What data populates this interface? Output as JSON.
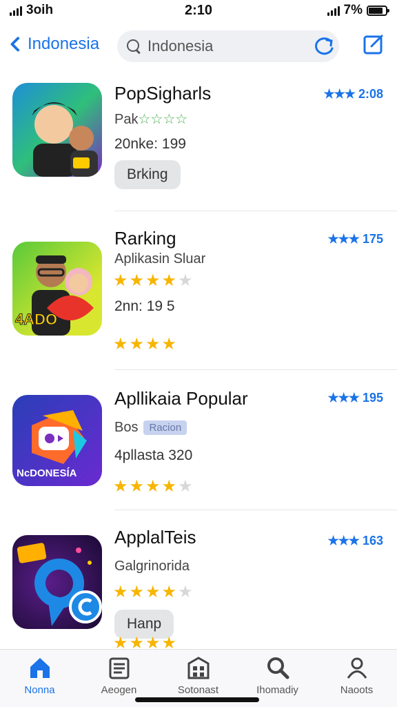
{
  "status_bar": {
    "carrier": "3oih",
    "time": "2:10",
    "battery": "7%"
  },
  "nav": {
    "back_label": "Indonesia",
    "search": {
      "value": "Indonesia",
      "placeholder": "Indonesia"
    }
  },
  "apps": [
    {
      "title": "PopSighar​ls",
      "subtitle": "Pak",
      "subtitle_stars": "☆☆☆☆",
      "meta": "20nke: 199",
      "right_stars": "★★★",
      "right_value": "2:08",
      "button": "Brking",
      "icon_colors": [
        "#1e8fd6",
        "#2fbf7a",
        "#7a2fbf"
      ],
      "icon_text": ""
    },
    {
      "title": "Rarking",
      "subtitle": "Aplikasin Sluar",
      "rating": 4,
      "meta": "2nn: 19 5",
      "right_stars": "★★★",
      "right_value": "175",
      "bottom_rating": 4,
      "icon_colors": [
        "#58c93a",
        "#d8e630",
        "#e8332b"
      ],
      "icon_text": "4ADO"
    },
    {
      "title": "Apllikaia Popular",
      "subtitle": "Bos",
      "badge": "Racion",
      "meta": "4pllasta 320",
      "right_stars": "★★★",
      "right_value": "195",
      "rating": 4,
      "icon_colors": [
        "#2a3fb8",
        "#6a2ad0",
        "#ff6b2b"
      ],
      "icon_text": "NcDONESÍA"
    },
    {
      "title": "ApplalTeis",
      "subtitle": "Galgrinorida",
      "rating": 4,
      "button": "Hanp",
      "right_stars": "★★★",
      "right_value": "163",
      "bottom_rating": 4,
      "icon_colors": [
        "#2a0e4a",
        "#1e88e5",
        "#ff4d9a"
      ],
      "icon_text": ""
    }
  ],
  "tabs": [
    {
      "label": "Nonna",
      "icon": "home-icon",
      "active": true
    },
    {
      "label": "Aeogen",
      "icon": "list-icon",
      "active": false
    },
    {
      "label": "Sotonast",
      "icon": "store-icon",
      "active": false
    },
    {
      "label": "Ihomadiy",
      "icon": "search-icon",
      "active": false
    },
    {
      "label": "Naoots",
      "icon": "person-icon",
      "active": false
    }
  ],
  "colors": {
    "accent": "#1a73e8",
    "star": "#f7b500"
  }
}
